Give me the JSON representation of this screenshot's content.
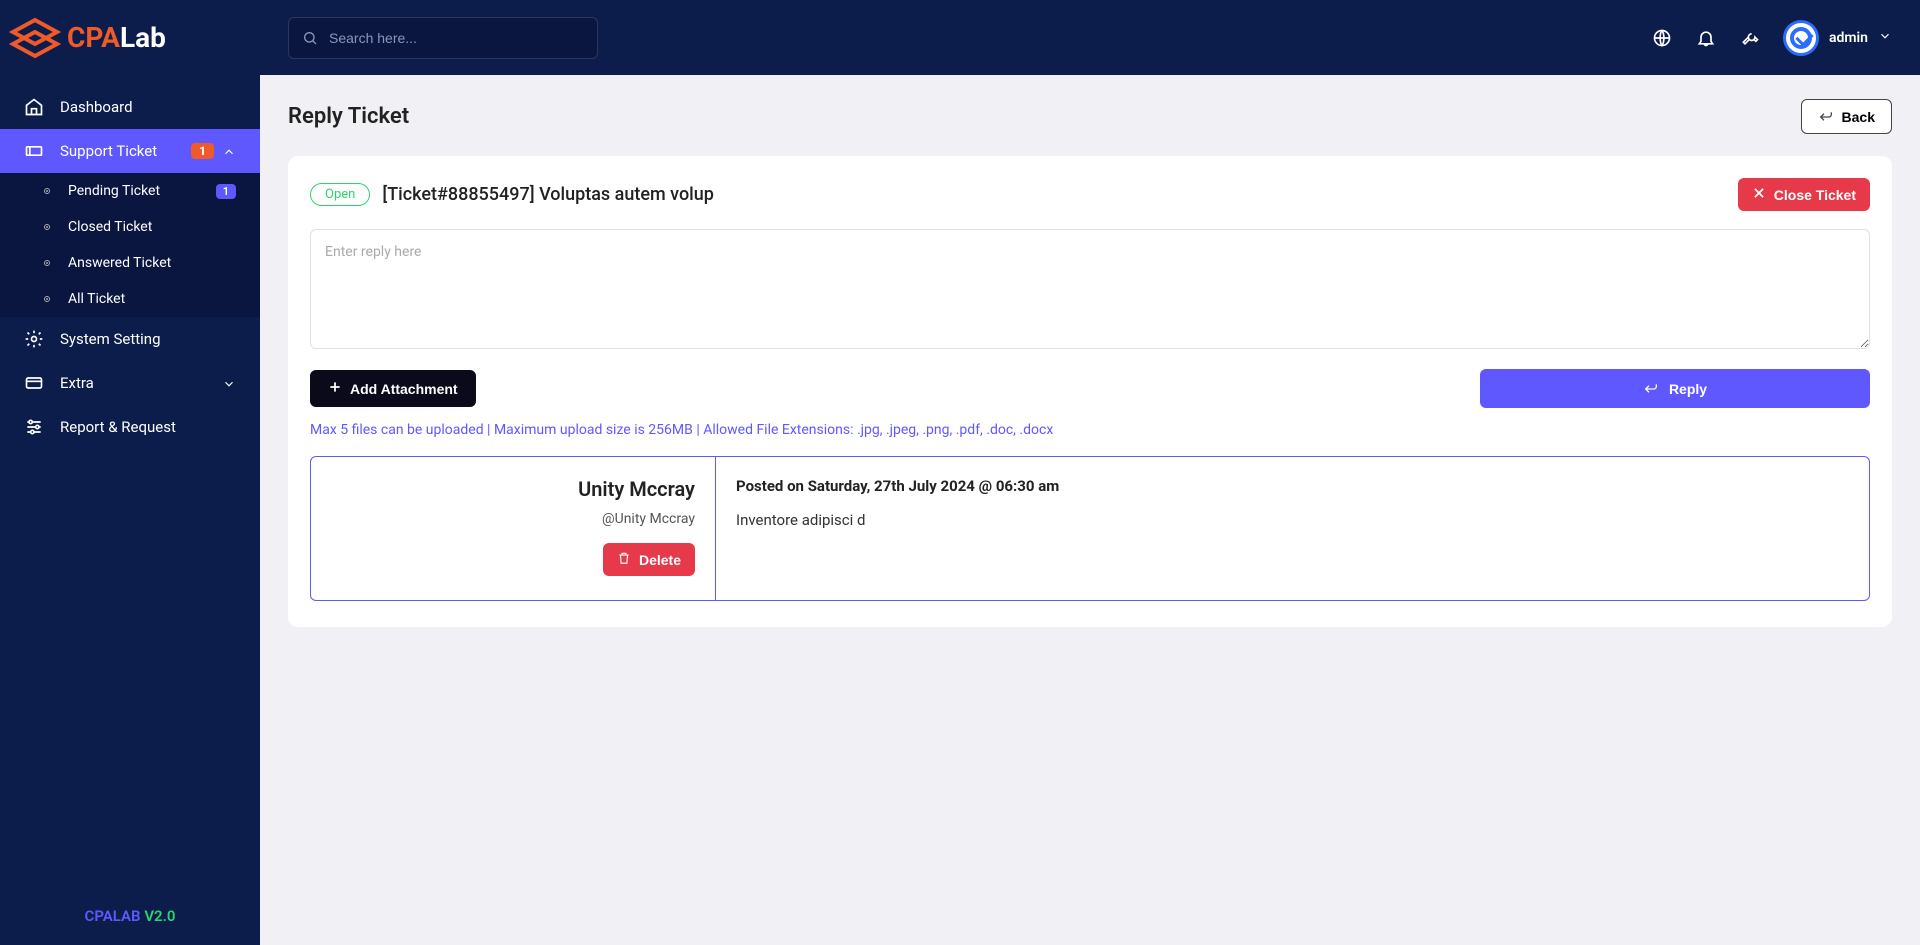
{
  "logo": {
    "cpa": "CPA",
    "lab": "Lab"
  },
  "search": {
    "placeholder": "Search here..."
  },
  "user": {
    "name": "admin"
  },
  "sidebar": {
    "items": [
      {
        "label": "Dashboard"
      },
      {
        "label": "Support Ticket",
        "badge": "1"
      },
      {
        "label": "System Setting"
      },
      {
        "label": "Extra"
      },
      {
        "label": "Report & Request"
      }
    ],
    "subitems": [
      {
        "label": "Pending Ticket",
        "count": "1"
      },
      {
        "label": "Closed Ticket"
      },
      {
        "label": "Answered Ticket"
      },
      {
        "label": "All Ticket"
      }
    ]
  },
  "footer": {
    "brand": "CPALAB ",
    "version": "V2.0"
  },
  "page": {
    "title": "Reply Ticket",
    "back": "Back"
  },
  "ticket": {
    "status": "Open",
    "title": "[Ticket#88855497] Voluptas autem volup",
    "close": "Close Ticket",
    "reply_placeholder": "Enter reply here",
    "add_attachment": "Add Attachment",
    "reply": "Reply",
    "hint": "Max 5 files can be uploaded | Maximum upload size is 256MB | Allowed File Extensions: .jpg, .jpeg, .png, .pdf, .doc, .docx"
  },
  "message": {
    "user": "Unity Mccray",
    "handle": "@Unity Mccray",
    "delete": "Delete",
    "posted": "Posted on Saturday, 27th July 2024 @ 06:30 am",
    "body": "Inventore adipisci d"
  }
}
